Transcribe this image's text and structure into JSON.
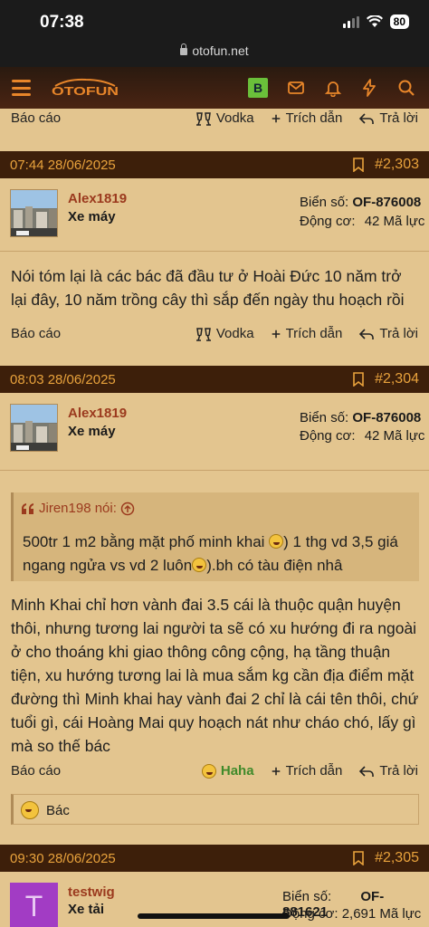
{
  "status_bar": {
    "time": "07:38",
    "battery": "80"
  },
  "browser": {
    "url": "otofun.net"
  },
  "nav": {
    "logo_text": "OTOFUN",
    "badge": "B"
  },
  "labels": {
    "report": "Báo cáo",
    "vodka": "Vodka",
    "quote_reply": "Trích dẫn",
    "reply": "Trả lời",
    "plate_label": "Biển số:",
    "engine_label": "Động cơ:",
    "haha": "Haha"
  },
  "posts": [
    {
      "date": "07:44 28/06/2025",
      "number": "#2,303",
      "user": "Alex1819",
      "rank": "Xe máy",
      "plate": "OF-876008",
      "engine": "42 Mã lực",
      "text": "Nói tóm lại là các bác đã đầu tư ở Hoài Đức 10 năm trở lại đây, 10 năm trồng cây thì sắp đến ngày thu hoạch rồi"
    },
    {
      "date": "08:03 28/06/2025",
      "number": "#2,304",
      "user": "Alex1819",
      "rank": "Xe máy",
      "plate": "OF-876008",
      "engine": "42 Mã lực",
      "quote_author": "Jiren198 nói:",
      "quote_part1": "500tr 1 m2 bằng mặt phố minh khai",
      "quote_part2": ") 1 thg vd 3,5 giá ngang ngửa vs vd 2 luôn",
      "quote_part3": ").bh có tàu điện nhâ",
      "text": "Minh Khai chỉ hơn vành đai 3.5 cái là thuộc quận huyện thôi, nhưng tương lai người ta sẽ có xu hướng đi ra ngoài ở cho thoáng khi giao thông công cộng, hạ tầng thuận tiện, xu hướng tương lai là mua sắm kg cần địa điểm mặt đường thì Minh khai hay vành đai 2 chỉ là cái tên thôi, chứ tuổi gì, cái Hoàng Mai quy hoạch nát như cháo chó, lấy gì mà so thế bác",
      "reaction_user": "Bác"
    },
    {
      "date": "09:30 28/06/2025",
      "number": "#2,305",
      "user": "testwig",
      "rank": "Xe tải",
      "avatar_letter": "T",
      "plate": "OF-881621",
      "engine": "2,691 Mã lực"
    }
  ],
  "colors": {
    "page_bg": "#e3c58f",
    "header_bg": "#3d1f0a",
    "accent_orange": "#e8862a",
    "username": "#9b3a1e",
    "haha_green": "#3f8a2a",
    "avatar_purple": "#a23cc4"
  },
  "icons": [
    "menu-icon",
    "logo",
    "envelope-icon",
    "bell-icon",
    "bolt-icon",
    "search-icon",
    "bookmark-icon",
    "vodka-icon",
    "plus-icon",
    "reply-icon",
    "quote-mark-icon",
    "arrow-up-circle-icon",
    "haha-emoji-icon"
  ]
}
